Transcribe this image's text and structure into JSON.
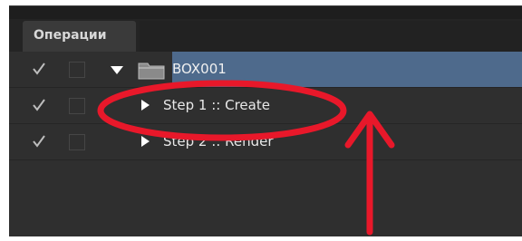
{
  "panel": {
    "tab_label": "Операции"
  },
  "rows": [
    {
      "kind": "set",
      "checked": true,
      "label": "BOX001",
      "expanded": true,
      "selected": true
    },
    {
      "kind": "action",
      "checked": true,
      "label": "Step 1 :: Create",
      "expanded": false
    },
    {
      "kind": "action",
      "checked": true,
      "label": "Step 2 :: Render",
      "expanded": false
    }
  ],
  "annotation": {
    "color": "#e8182a",
    "circled_item": "Step 1 :: Create"
  },
  "colors": {
    "panel_bg": "#2f2f2f",
    "selection": "#4e6a8c"
  }
}
